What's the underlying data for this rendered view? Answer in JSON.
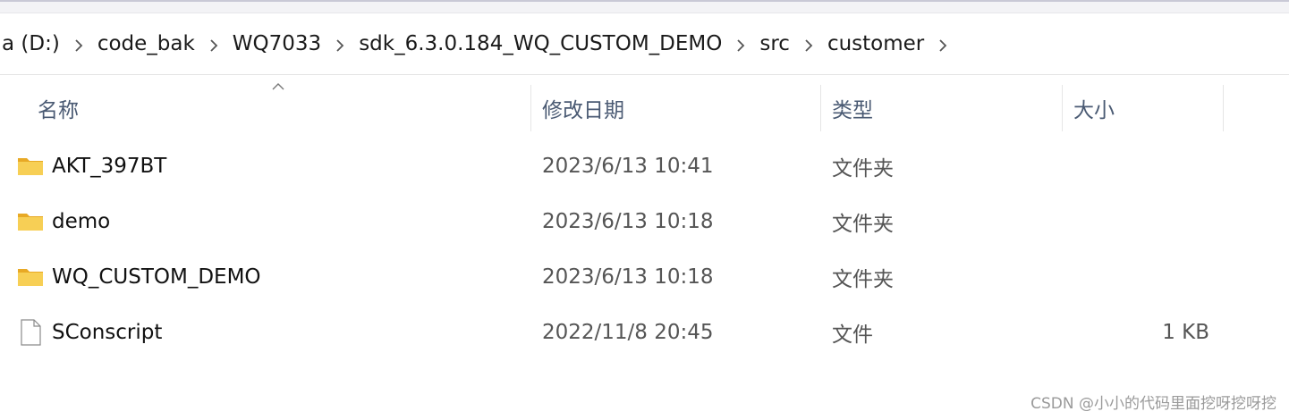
{
  "breadcrumb": {
    "items": [
      {
        "label": "a (D:)"
      },
      {
        "label": "code_bak"
      },
      {
        "label": "WQ7033"
      },
      {
        "label": "sdk_6.3.0.184_WQ_CUSTOM_DEMO"
      },
      {
        "label": "src"
      },
      {
        "label": "customer"
      }
    ]
  },
  "columns": {
    "name": "名称",
    "date": "修改日期",
    "type": "类型",
    "size": "大小"
  },
  "files": [
    {
      "icon": "folder-icon",
      "name": "AKT_397BT",
      "date": "2023/6/13 10:41",
      "type": "文件夹",
      "size": ""
    },
    {
      "icon": "folder-icon",
      "name": "demo",
      "date": "2023/6/13 10:18",
      "type": "文件夹",
      "size": ""
    },
    {
      "icon": "folder-icon",
      "name": "WQ_CUSTOM_DEMO",
      "date": "2023/6/13 10:18",
      "type": "文件夹",
      "size": ""
    },
    {
      "icon": "file-icon",
      "name": "SConscript",
      "date": "2022/11/8 20:45",
      "type": "文件",
      "size": "1 KB"
    }
  ],
  "watermark": "CSDN @小小的代码里面挖呀挖呀挖",
  "colors": {
    "folder": "#f5c542",
    "header_text": "#4a5a73",
    "secondary_text": "#555555"
  }
}
